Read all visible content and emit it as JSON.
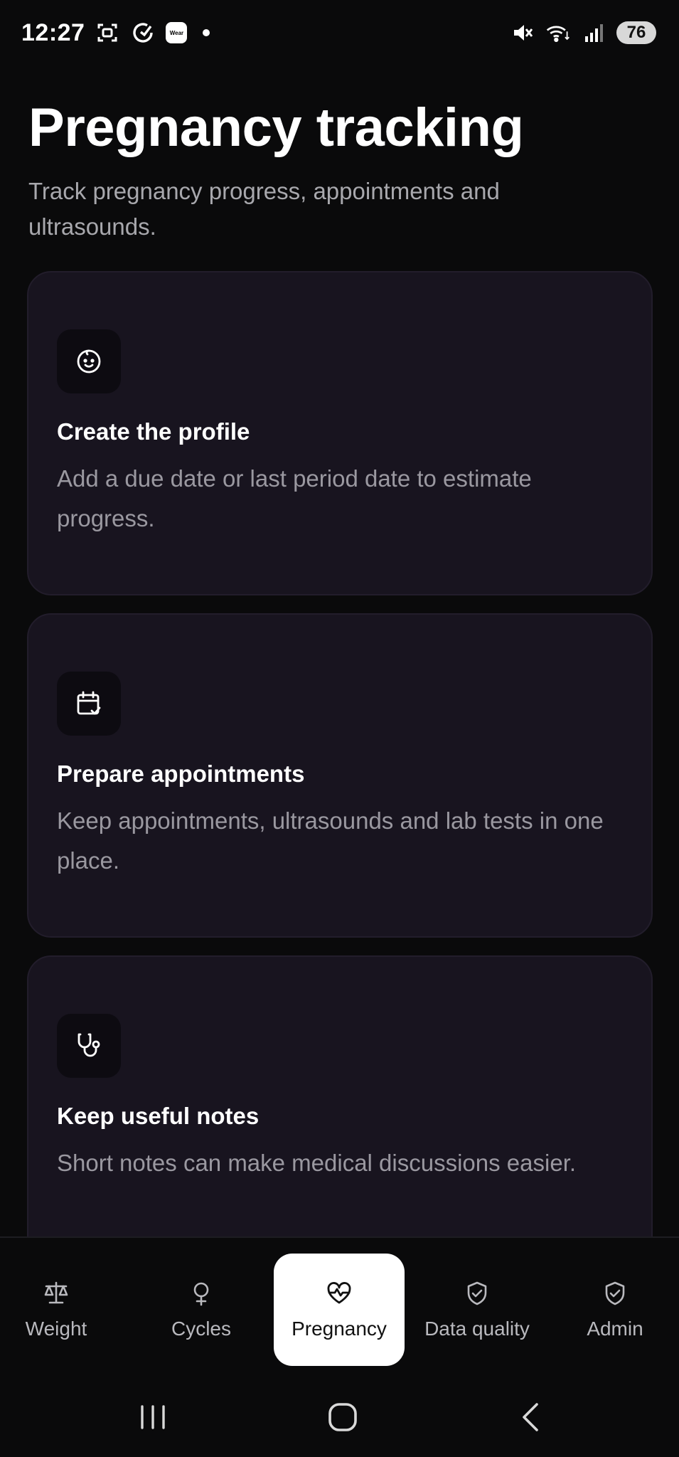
{
  "status_bar": {
    "time": "12:27",
    "wear_label": "Wear",
    "battery": "76",
    "icons": [
      "screenshot-icon",
      "sync-icon",
      "wear-icon",
      "notification-dot",
      "mute-icon",
      "wifi-icon",
      "signal-icon",
      "battery-icon"
    ]
  },
  "header": {
    "title": "Pregnancy tracking",
    "subtitle": "Track pregnancy progress, appointments and ultrasounds."
  },
  "cards": [
    {
      "icon": "baby-icon",
      "title": "Create the profile",
      "description": "Add a due date or last period date to estimate progress."
    },
    {
      "icon": "calendar-check-icon",
      "title": "Prepare appointments",
      "description": "Keep appointments, ultrasounds and lab tests in one place."
    },
    {
      "icon": "stethoscope-icon",
      "title": "Keep useful notes",
      "description": "Short notes can make medical discussions easier."
    }
  ],
  "bottom_nav": {
    "items": [
      {
        "label": "Weight",
        "icon": "scale-icon",
        "active": false
      },
      {
        "label": "Cycles",
        "icon": "female-symbol-icon",
        "active": false
      },
      {
        "label": "Pregnancy",
        "icon": "heart-pulse-icon",
        "active": true
      },
      {
        "label": "Data quality",
        "icon": "shield-check-icon",
        "active": false
      },
      {
        "label": "Admin",
        "icon": "shield-check-icon",
        "active": false
      }
    ]
  },
  "colors": {
    "background": "#0a0a0b",
    "card": "#18141f",
    "active_tab": "#ffffff",
    "muted_text": "#9a98a0"
  }
}
